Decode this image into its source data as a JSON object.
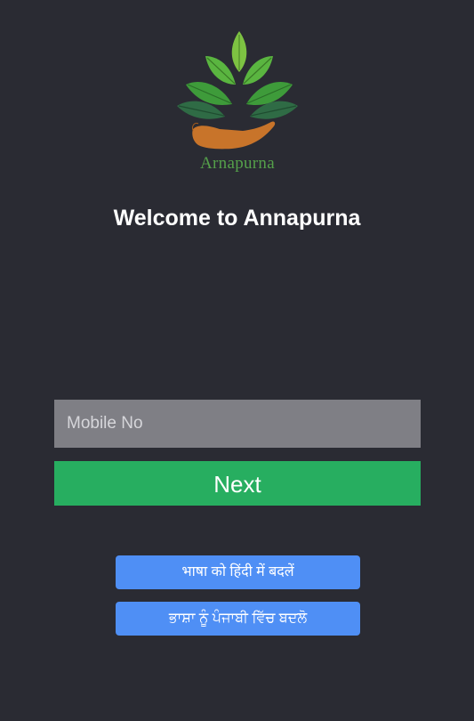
{
  "logo": {
    "text": "Arnapurna",
    "icon": "leaves-in-hand-icon"
  },
  "title": "Welcome to Annapurna",
  "form": {
    "mobile_placeholder": "Mobile No",
    "mobile_value": "",
    "next_label": "Next"
  },
  "language_buttons": {
    "hindi_label": "भाषा को हिंदी में बदलें",
    "punjabi_label": "ਭਾਸ਼ਾ ਨੂੰ ਪੰਜਾਬੀ ਵਿੱਚ ਬਦਲੋ"
  },
  "colors": {
    "background": "#2a2b33",
    "input_bg": "#7f7f85",
    "next_bg": "#27ae60",
    "language_bg": "#4f8ff5",
    "logo_green": "#55a04a",
    "logo_hand": "#c8742a"
  }
}
